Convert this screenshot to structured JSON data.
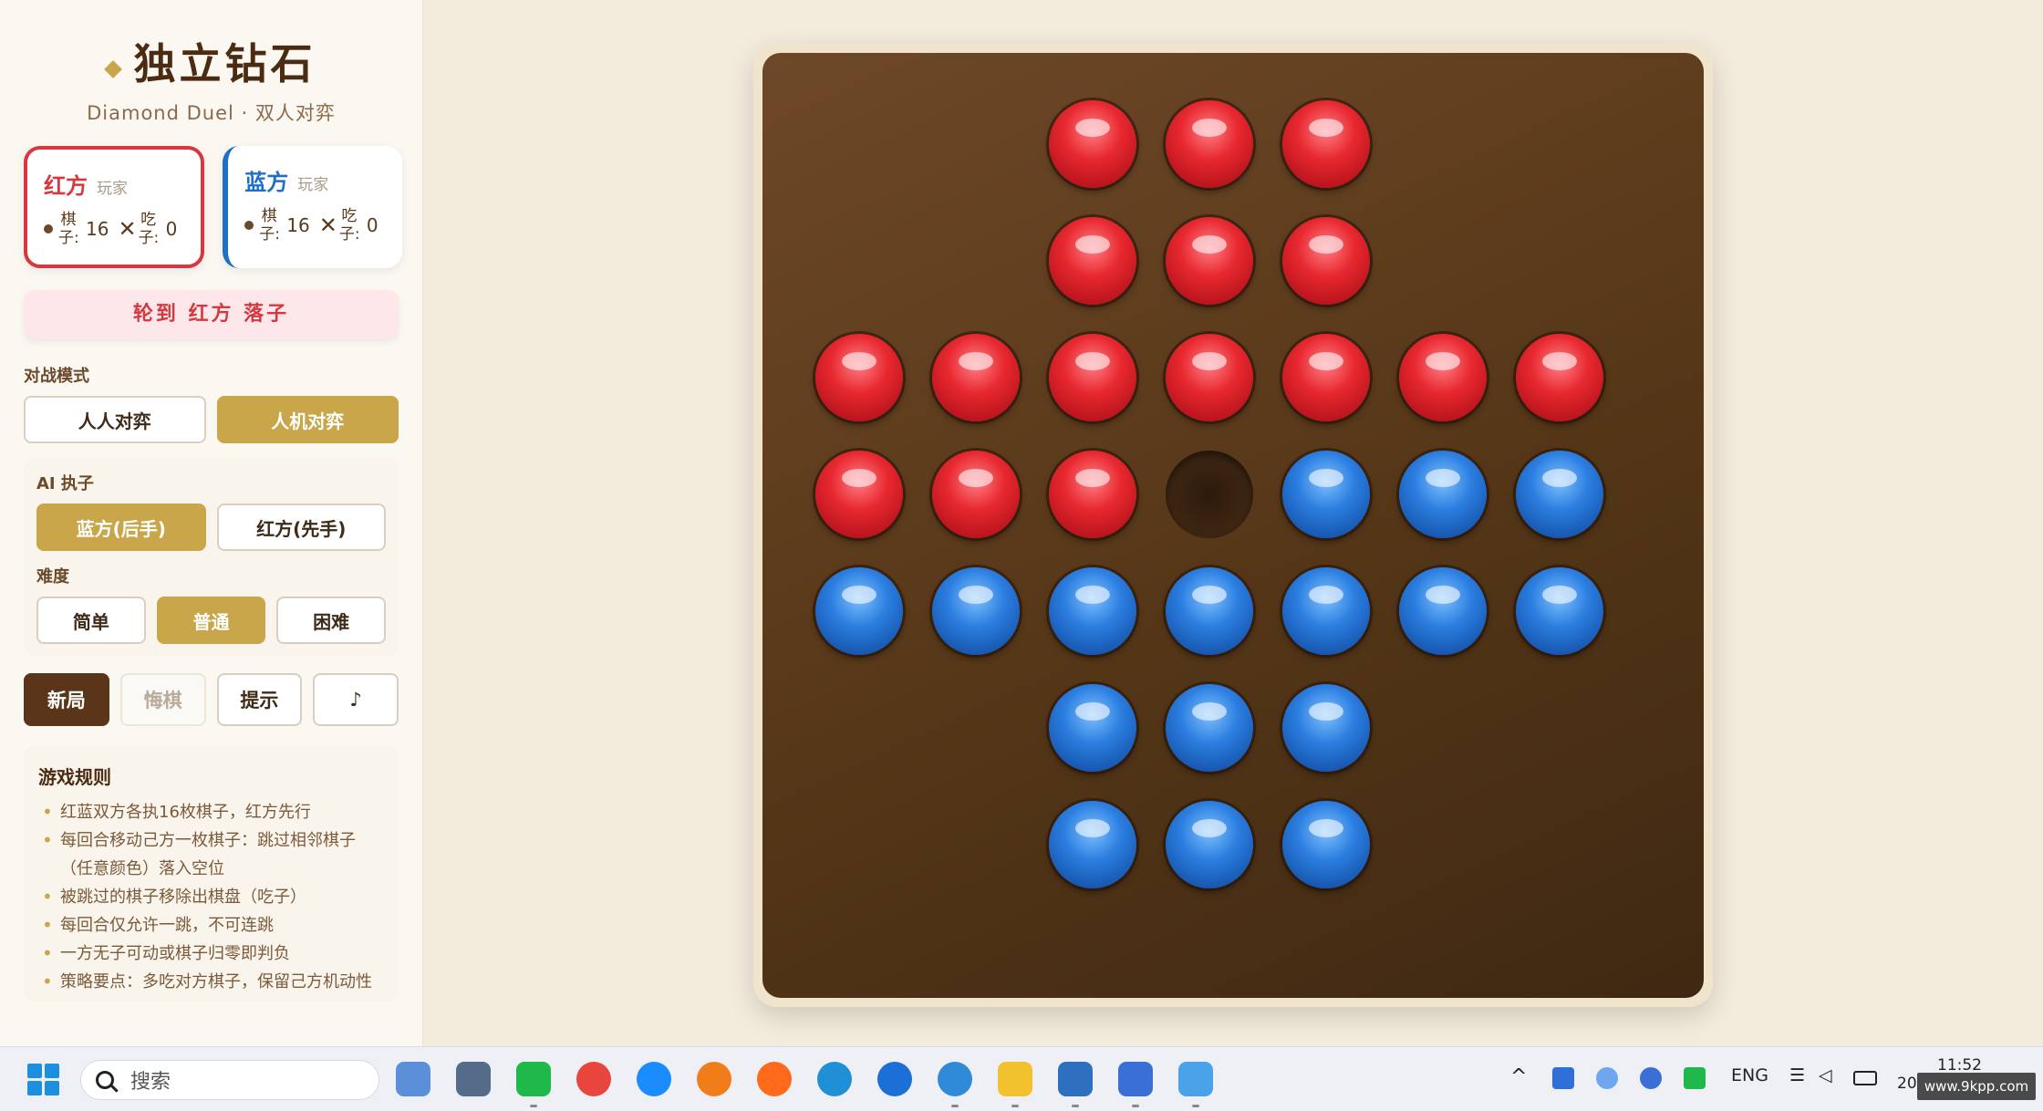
{
  "header": {
    "title": "独立钻石",
    "subtitle": "Diamond Duel · 双人对弈"
  },
  "players": {
    "red": {
      "name": "红方",
      "role": "玩家",
      "pieces_label_1": "棋",
      "pieces_label_2": "子:",
      "pieces": "16",
      "x": "✕",
      "captured_label_1": "吃",
      "captured_label_2": "子:",
      "captured": "0"
    },
    "blue": {
      "name": "蓝方",
      "role": "玩家",
      "pieces_label_1": "棋",
      "pieces_label_2": "子:",
      "pieces": "16",
      "x": "✕",
      "captured_label_1": "吃",
      "captured_label_2": "子:",
      "captured": "0"
    }
  },
  "turn_banner": "轮到 红方 落子",
  "mode": {
    "label": "对战模式",
    "options": [
      "人人对弈",
      "人机对弈"
    ],
    "selected": "人机对弈"
  },
  "ai": {
    "side_label": "AI 执子",
    "side_options": [
      "蓝方(后手)",
      "红方(先手)"
    ],
    "side_selected": "蓝方(后手)",
    "difficulty_label": "难度",
    "difficulty_options": [
      "简单",
      "普通",
      "困难"
    ],
    "difficulty_selected": "普通"
  },
  "actions": {
    "new_game": "新局",
    "undo": "悔棋",
    "hint": "提示",
    "music": "♪"
  },
  "rules": {
    "title": "游戏规则",
    "items": [
      "红蓝双方各执16枚棋子，红方先行",
      "每回合移动己方一枚棋子：跳过相邻棋子",
      "（任意颜色）落入空位",
      "被跳过的棋子移除出棋盘（吃子）",
      "每回合仅允许一跳，不可连跳",
      "一方无子可动或棋子归零即判负",
      "策略要点：多吃对方棋子，保留己方机动性"
    ]
  },
  "board": {
    "layout": "english-cross",
    "rows": [
      [
        "-",
        "-",
        "R",
        "R",
        "R",
        "-",
        "-"
      ],
      [
        "-",
        "-",
        "R",
        "R",
        "R",
        "-",
        "-"
      ],
      [
        "R",
        "R",
        "R",
        "R",
        "R",
        "R",
        "R"
      ],
      [
        "R",
        "R",
        "R",
        "E",
        "B",
        "B",
        "B"
      ],
      [
        "B",
        "B",
        "B",
        "B",
        "B",
        "B",
        "B"
      ],
      [
        "-",
        "-",
        "B",
        "B",
        "B",
        "-",
        "-"
      ],
      [
        "-",
        "-",
        "B",
        "B",
        "B",
        "-",
        "-"
      ]
    ],
    "colors": {
      "red": "#e8282f",
      "blue": "#2b7ee0",
      "board": "#573818"
    }
  },
  "taskbar": {
    "search_placeholder": "搜索",
    "lang": "ENG",
    "time": "11:52",
    "date": "202",
    "watermark": "www.9kpp.com",
    "icons": [
      "snipping-tool-icon",
      "calculator-icon",
      "wechat-icon",
      "chrome-icon",
      "browser-icon",
      "app-icon",
      "firefox-icon",
      "edge-icon",
      "ie-icon",
      "cloud-app-icon",
      "file-explorer-icon",
      "vscode-icon",
      "onedrive-icon",
      "baidu-netdisk-icon"
    ]
  }
}
